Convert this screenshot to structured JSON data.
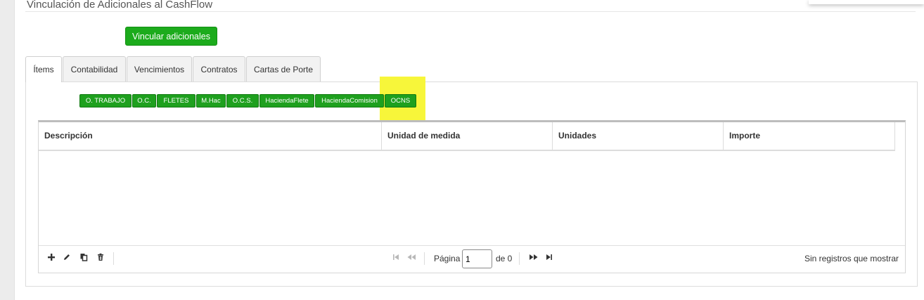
{
  "page": {
    "title": "Vinculación de Adicionales al CashFlow"
  },
  "actions": {
    "vincular_label": "Vincular adicionales"
  },
  "tabs": [
    {
      "label": "Ítems",
      "active": true
    },
    {
      "label": "Contabilidad"
    },
    {
      "label": "Vencimientos"
    },
    {
      "label": "Contratos"
    },
    {
      "label": "Cartas de Porte"
    }
  ],
  "chips": [
    "O. TRABAJO",
    "O.C.",
    "FLETES",
    "M.Hac",
    "O.C.S.",
    "HaciendaFlete",
    "HaciendaComision",
    "OCNS"
  ],
  "grid": {
    "columns": [
      "Descripción",
      "Unidad de medida",
      "Unidades",
      "Importe"
    ],
    "rows": []
  },
  "pager": {
    "page_label": "Página",
    "page_value": "1",
    "of_label": "de 0",
    "status": "Sin registros que mostrar"
  },
  "colors": {
    "accent_green": "#1cab1c",
    "highlight": "#f7f63a"
  }
}
